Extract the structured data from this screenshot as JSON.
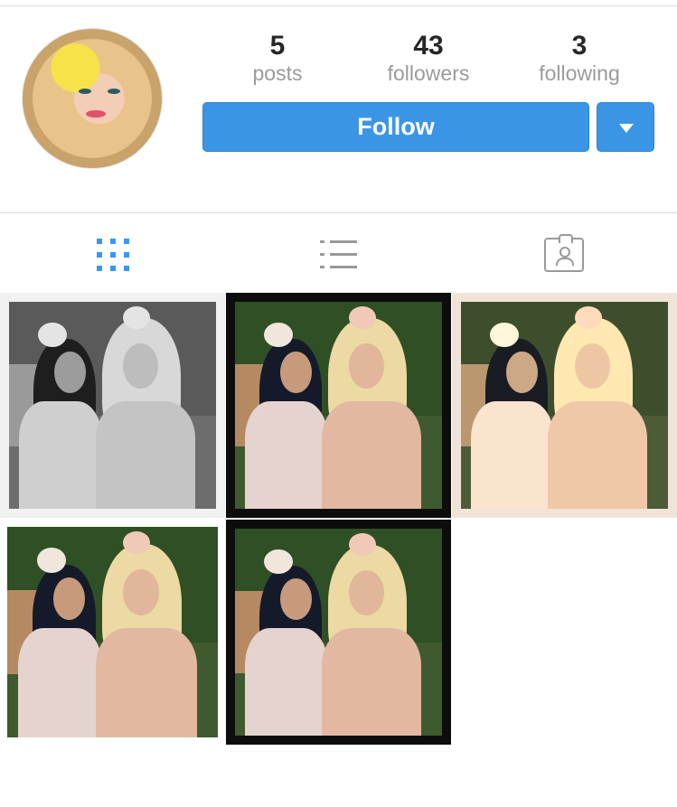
{
  "profile": {
    "stats": {
      "posts": {
        "value": "5",
        "label": "posts"
      },
      "followers": {
        "value": "43",
        "label": "followers"
      },
      "following": {
        "value": "3",
        "label": "following"
      }
    },
    "follow_label": "Follow",
    "accent_color": "#3b95e5"
  },
  "tabs": [
    {
      "name": "grid",
      "icon": "grid-icon",
      "selected": true
    },
    {
      "name": "list",
      "icon": "list-icon",
      "selected": false
    },
    {
      "name": "tagged",
      "icon": "tagged-photos-icon",
      "selected": false
    }
  ],
  "posts": [
    {
      "style": "black-and-white"
    },
    {
      "style": "dark-frame"
    },
    {
      "style": "warm-frame"
    },
    {
      "style": "plain"
    },
    {
      "style": "dark-frame"
    }
  ]
}
